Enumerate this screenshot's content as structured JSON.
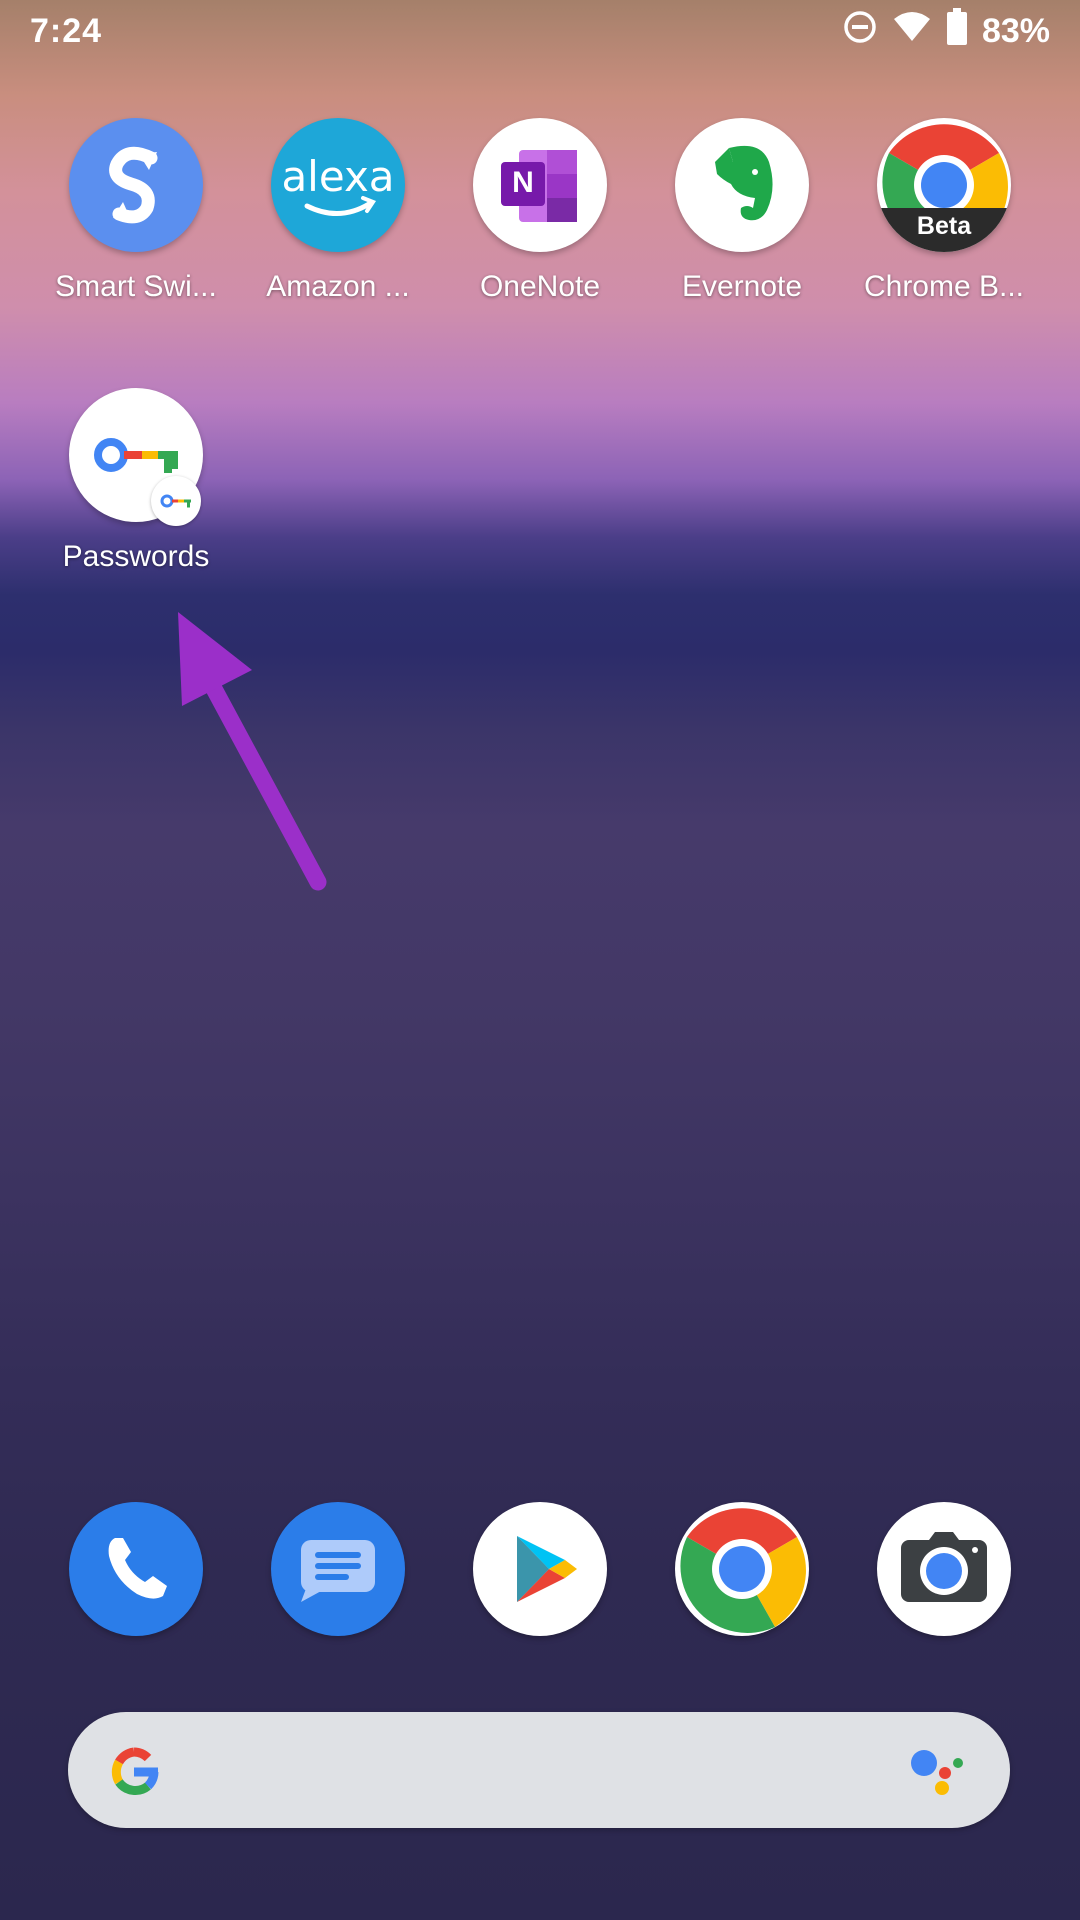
{
  "status_bar": {
    "time": "7:24",
    "battery_percent": "83%",
    "icons": [
      "do-not-disturb-icon",
      "wifi-icon",
      "battery-icon"
    ]
  },
  "apps": [
    {
      "label": "Smart Swi...",
      "icon": "smart-switch-icon"
    },
    {
      "label": "Amazon ...",
      "icon": "alexa-icon",
      "icon_text": "alexa"
    },
    {
      "label": "OneNote",
      "icon": "onenote-icon",
      "icon_text": "N"
    },
    {
      "label": "Evernote",
      "icon": "evernote-icon"
    },
    {
      "label": "Chrome B...",
      "icon": "chrome-beta-icon",
      "icon_text": "Beta"
    },
    {
      "label": "Passwords",
      "icon": "passwords-key-icon"
    }
  ],
  "dock": [
    {
      "icon": "phone-icon"
    },
    {
      "icon": "messages-icon"
    },
    {
      "icon": "play-store-icon"
    },
    {
      "icon": "chrome-icon"
    },
    {
      "icon": "camera-icon"
    }
  ],
  "search_bar": {
    "icons": [
      "google-g-icon",
      "assistant-icon"
    ]
  },
  "annotation": {
    "color": "#9b2fc9",
    "icon": "arrow-annotation"
  },
  "colors": {
    "google_blue": "#4285f4",
    "google_red": "#ea4335",
    "google_yellow": "#fbbc04",
    "google_green": "#34a853"
  }
}
